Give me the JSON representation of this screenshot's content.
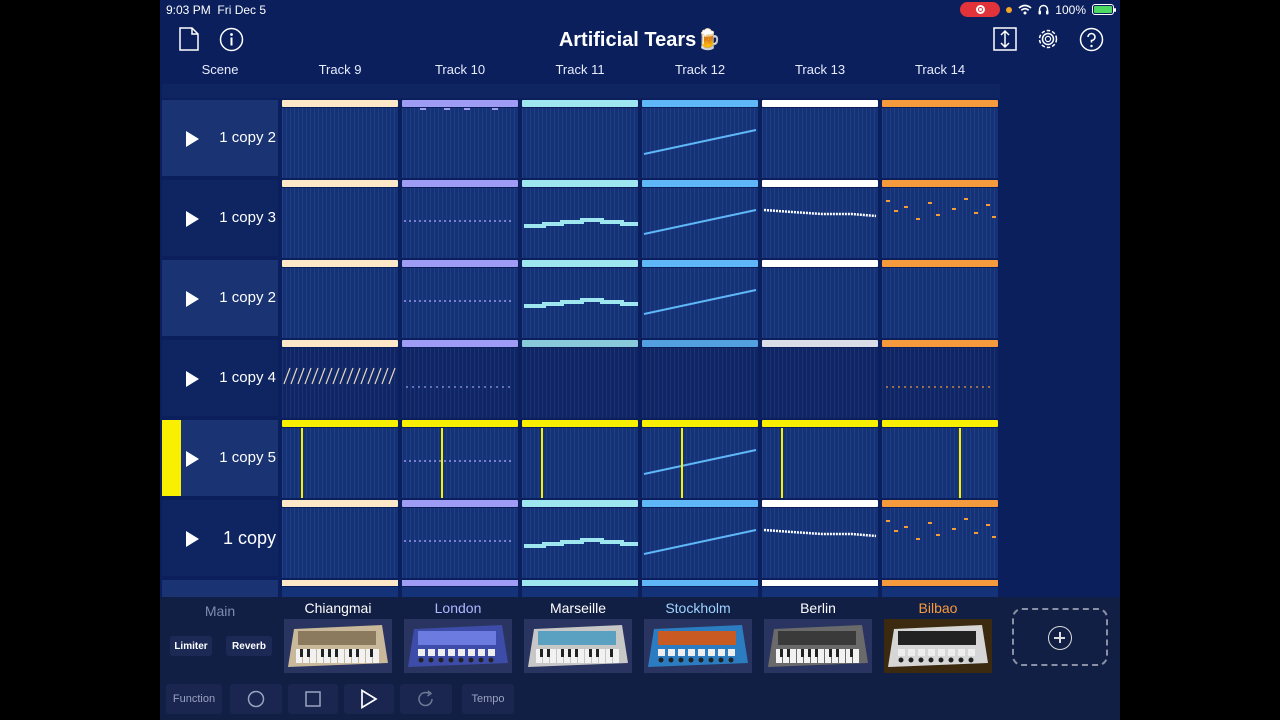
{
  "status": {
    "time": "9:03 PM",
    "date": "Fri Dec 5",
    "battery": "100%"
  },
  "app": {
    "title": "Artificial Tears🍺"
  },
  "columns": {
    "scene": "Scene",
    "tracks": [
      "Track 9",
      "Track 10",
      "Track 11",
      "Track 12",
      "Track 13",
      "Track 14"
    ]
  },
  "track_colors": [
    "#fde8c8",
    "#9f9cf5",
    "#9fe7f0",
    "#5fb7f7",
    "#ffffff",
    "#f59a3d"
  ],
  "active_color": "#f8f000",
  "scenes": [
    {
      "label": "1 copy 2",
      "playing": false
    },
    {
      "label": "1 copy 3",
      "playing": false
    },
    {
      "label": "1 copy 2",
      "playing": false
    },
    {
      "label": "1 copy 4",
      "playing": false
    },
    {
      "label": "1 copy 5",
      "playing": true
    },
    {
      "label": "1 copy",
      "playing": false
    }
  ],
  "bottom": {
    "main_label": "Main",
    "fx": [
      "Limiter",
      "Reverb"
    ],
    "instruments": [
      {
        "name": "Chiangmai",
        "color": "#ffffff",
        "icon": "synth-keyboard-icon"
      },
      {
        "name": "London",
        "color": "#aeb8ff",
        "icon": "drum-machine-icon"
      },
      {
        "name": "Marseille",
        "color": "#ffffff",
        "icon": "synth-keyboard-icon"
      },
      {
        "name": "Stockholm",
        "color": "#9fd3ff",
        "icon": "vintage-synth-icon"
      },
      {
        "name": "Berlin",
        "color": "#ffffff",
        "icon": "modular-synth-icon"
      },
      {
        "name": "Bilbao",
        "color": "#f59a3d",
        "icon": "sampler-pads-icon"
      }
    ]
  },
  "transport": {
    "function": "Function",
    "tempo": "Tempo"
  },
  "icons": [
    "new-document-icon",
    "info-icon",
    "export-icon",
    "settings-gear-icon",
    "help-icon",
    "record-icon",
    "stop-icon",
    "play-icon",
    "loop-icon",
    "add-icon"
  ]
}
